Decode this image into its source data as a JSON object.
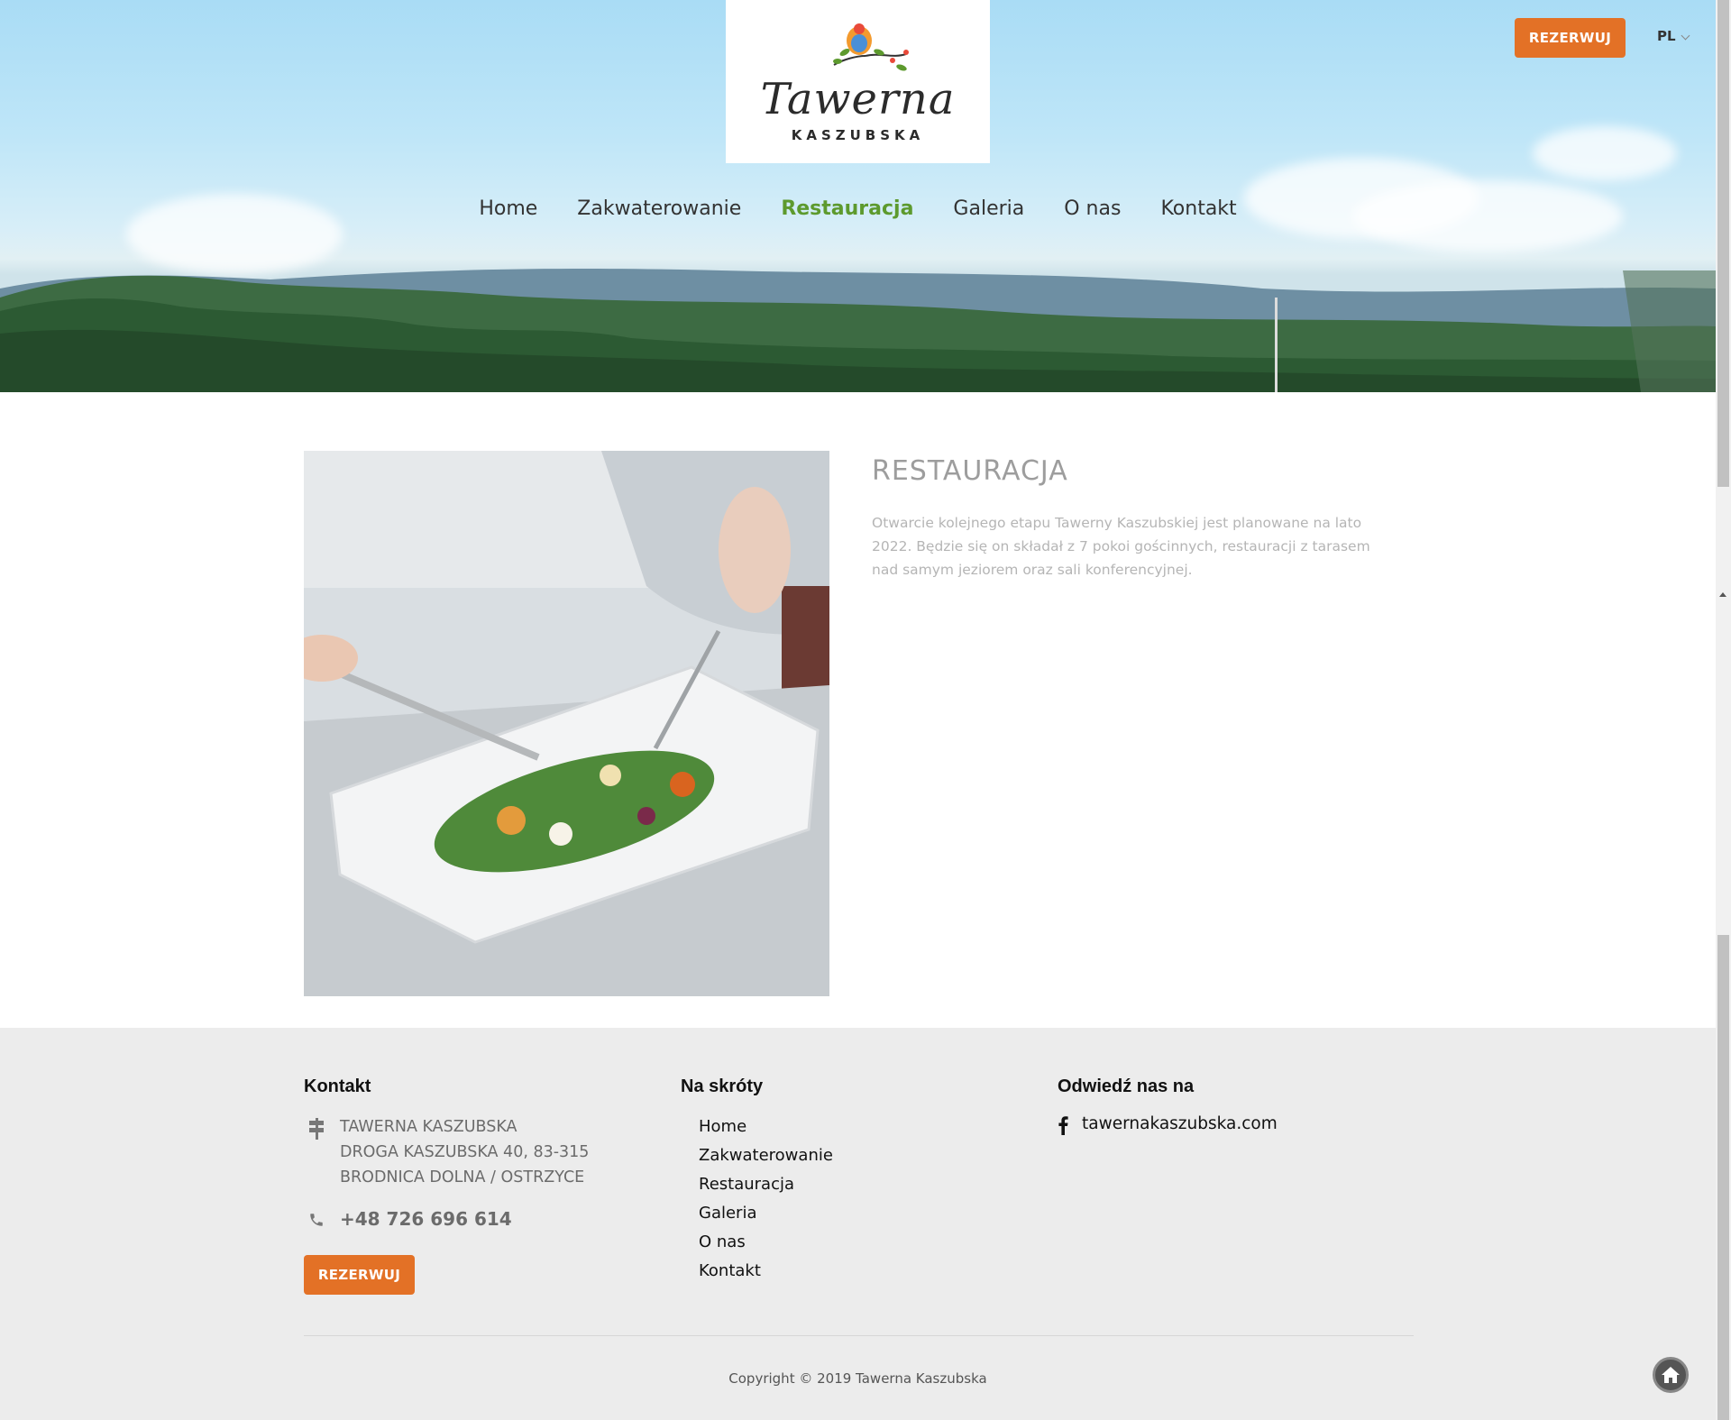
{
  "header": {
    "logo_script": "Tawerna",
    "logo_sub": "KASZUBSKA",
    "book_label": "REZERWUJ",
    "language": "PL"
  },
  "nav": [
    {
      "label": "Home",
      "active": false
    },
    {
      "label": "Zakwaterowanie",
      "active": false
    },
    {
      "label": "Restauracja",
      "active": true
    },
    {
      "label": "Galeria",
      "active": false
    },
    {
      "label": "O nas",
      "active": false
    },
    {
      "label": "Kontakt",
      "active": false
    }
  ],
  "section": {
    "title": "RESTAURACJA",
    "text": "Otwarcie kolejnego etapu Tawerny Kaszubskiej jest planowane na lato 2022. Będzie się on składał z 7 pokoi gościnnych, restauracji z tarasem nad samym jeziorem oraz sali konferencyjnej."
  },
  "footer": {
    "contact_heading": "Kontakt",
    "address_line1": "TAWERNA KASZUBSKA",
    "address_line2": "DROGA KASZUBSKA 40, 83-315",
    "address_line3": "BRODNICA DOLNA / OSTRZYCE",
    "phone": "+48 726 696 614",
    "book_label": "REZERWUJ",
    "shortcuts_heading": "Na skróty",
    "shortcuts": [
      "Home",
      "Zakwaterowanie",
      "Restauracja",
      "Galeria",
      "O nas",
      "Kontakt"
    ],
    "visit_heading": "Odwiedź nas na",
    "facebook_text": "tawernakaszubska.com",
    "copyright": "Copyright © 2019 Tawerna Kaszubska"
  },
  "colors": {
    "accent_orange": "#e37126",
    "active_nav_green": "#5d9a2e",
    "footer_bg": "#ececec"
  },
  "icons": [
    "flower-logo-icon",
    "signpost-icon",
    "phone-icon",
    "facebook-icon",
    "home-icon",
    "chevron-down-icon"
  ]
}
